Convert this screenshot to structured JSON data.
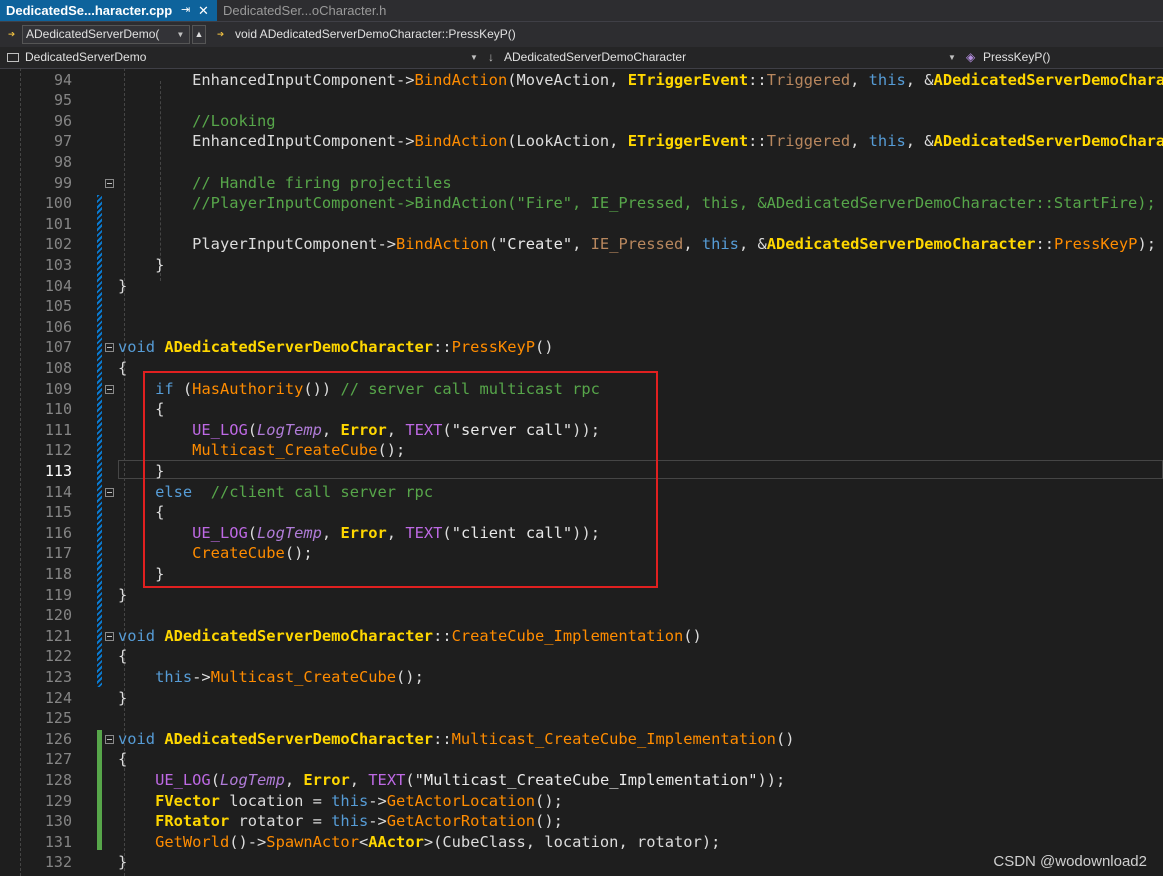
{
  "tabs": [
    {
      "label": "DedicatedSe...haracter.cpp",
      "active": true
    },
    {
      "label": "DedicatedSer...oCharacter.h",
      "active": false
    }
  ],
  "tab_icons": {
    "pin": "pin-icon",
    "close": "close-icon"
  },
  "toolbar": {
    "class_combo": "ADedicatedServerDemo(",
    "function_text": "void ADedicatedServerDemoCharacter::PressKeyP()"
  },
  "navbar": {
    "project": "DedicatedServerDemo",
    "scope": "ADedicatedServerDemoCharacter",
    "member": "PressKeyP()"
  },
  "editor": {
    "accent_colors": {
      "keyword": "#569cd6",
      "type": "#ffd700",
      "function": "#ff8c00",
      "macro": "#be69e4",
      "comment": "#57a64a"
    },
    "lines": [
      {
        "n": "94",
        "tokens": [
          [
            "        ",
            ""
          ],
          [
            "EnhancedInputComponent",
            "pl"
          ],
          [
            "->",
            ""
          ],
          [
            "BindAction",
            "fn"
          ],
          [
            "(MoveAction, ",
            ""
          ],
          [
            "ETriggerEvent",
            "ty"
          ],
          [
            "::",
            ""
          ],
          [
            "Triggered",
            "enm"
          ],
          [
            ", ",
            ""
          ],
          [
            "this",
            "kw"
          ],
          [
            ", &",
            ""
          ],
          [
            "ADedicatedServerDemoCharacter",
            "ty"
          ]
        ]
      },
      {
        "n": "95",
        "tokens": []
      },
      {
        "n": "96",
        "tokens": [
          [
            "        ",
            ""
          ],
          [
            "//Looking",
            "com"
          ]
        ]
      },
      {
        "n": "97",
        "tokens": [
          [
            "        ",
            ""
          ],
          [
            "EnhancedInputComponent",
            "pl"
          ],
          [
            "->",
            ""
          ],
          [
            "BindAction",
            "fn"
          ],
          [
            "(LookAction, ",
            ""
          ],
          [
            "ETriggerEvent",
            "ty"
          ],
          [
            "::",
            ""
          ],
          [
            "Triggered",
            "enm"
          ],
          [
            ", ",
            ""
          ],
          [
            "this",
            "kw"
          ],
          [
            ", &",
            ""
          ],
          [
            "ADedicatedServerDemoCharacter",
            "ty"
          ]
        ]
      },
      {
        "n": "98",
        "tokens": []
      },
      {
        "n": "99",
        "tokens": [
          [
            "        ",
            ""
          ],
          [
            "// Handle firing projectiles",
            "com"
          ]
        ]
      },
      {
        "n": "100",
        "tokens": [
          [
            "        ",
            ""
          ],
          [
            "//PlayerInputComponent->BindAction(\"Fire\", IE_Pressed, this, &ADedicatedServerDemoCharacter::StartFire);",
            "com"
          ]
        ]
      },
      {
        "n": "101",
        "tokens": []
      },
      {
        "n": "102",
        "tokens": [
          [
            "        ",
            ""
          ],
          [
            "PlayerInputComponent",
            ""
          ],
          [
            "->",
            ""
          ],
          [
            "BindAction",
            "fn"
          ],
          [
            "(",
            ""
          ],
          [
            "\"Create\"",
            "str"
          ],
          [
            ", ",
            ""
          ],
          [
            "IE_Pressed",
            "enm"
          ],
          [
            ", ",
            ""
          ],
          [
            "this",
            "kw"
          ],
          [
            ", &",
            ""
          ],
          [
            "ADedicatedServerDemoCharacter",
            "ty"
          ],
          [
            "::",
            ""
          ],
          [
            "PressKeyP",
            "fn"
          ],
          [
            ");",
            ""
          ]
        ]
      },
      {
        "n": "103",
        "tokens": [
          [
            "    }",
            ""
          ]
        ]
      },
      {
        "n": "104",
        "tokens": [
          [
            "}",
            ""
          ]
        ]
      },
      {
        "n": "105",
        "tokens": []
      },
      {
        "n": "106",
        "tokens": []
      },
      {
        "n": "107",
        "tokens": [
          [
            "void",
            "kw"
          ],
          [
            " ",
            ""
          ],
          [
            "ADedicatedServerDemoCharacter",
            "ty"
          ],
          [
            "::",
            ""
          ],
          [
            "PressKeyP",
            "fn"
          ],
          [
            "()",
            ""
          ]
        ]
      },
      {
        "n": "108",
        "tokens": [
          [
            "{",
            ""
          ]
        ]
      },
      {
        "n": "109",
        "tokens": [
          [
            "    ",
            ""
          ],
          [
            "if",
            "kw"
          ],
          [
            " (",
            ""
          ],
          [
            "HasAuthority",
            "fn"
          ],
          [
            "()) ",
            ""
          ],
          [
            "// server call multicast rpc",
            "com"
          ]
        ]
      },
      {
        "n": "110",
        "tokens": [
          [
            "    {",
            ""
          ]
        ]
      },
      {
        "n": "111",
        "tokens": [
          [
            "        ",
            ""
          ],
          [
            "UE_LOG",
            "mac"
          ],
          [
            "(",
            ""
          ],
          [
            "LogTemp",
            "ital"
          ],
          [
            ", ",
            ""
          ],
          [
            "Error",
            "ty"
          ],
          [
            ", ",
            ""
          ],
          [
            "TEXT",
            "mac"
          ],
          [
            "(",
            ""
          ],
          [
            "\"server call\"",
            "str"
          ],
          [
            "));",
            ""
          ]
        ]
      },
      {
        "n": "112",
        "tokens": [
          [
            "        ",
            ""
          ],
          [
            "Multicast_CreateCube",
            "fn"
          ],
          [
            "();",
            ""
          ]
        ]
      },
      {
        "n": "113",
        "tokens": [
          [
            "    }",
            ""
          ]
        ]
      },
      {
        "n": "114",
        "tokens": [
          [
            "    ",
            ""
          ],
          [
            "else",
            "kw"
          ],
          [
            "  ",
            ""
          ],
          [
            "//client call server rpc",
            "com"
          ]
        ]
      },
      {
        "n": "115",
        "tokens": [
          [
            "    {",
            ""
          ]
        ]
      },
      {
        "n": "116",
        "tokens": [
          [
            "        ",
            ""
          ],
          [
            "UE_LOG",
            "mac"
          ],
          [
            "(",
            ""
          ],
          [
            "LogTemp",
            "ital"
          ],
          [
            ", ",
            ""
          ],
          [
            "Error",
            "ty"
          ],
          [
            ", ",
            ""
          ],
          [
            "TEXT",
            "mac"
          ],
          [
            "(",
            ""
          ],
          [
            "\"client call\"",
            "str"
          ],
          [
            "));",
            ""
          ]
        ]
      },
      {
        "n": "117",
        "tokens": [
          [
            "        ",
            ""
          ],
          [
            "CreateCube",
            "fn"
          ],
          [
            "();",
            ""
          ]
        ]
      },
      {
        "n": "118",
        "tokens": [
          [
            "    }",
            ""
          ]
        ]
      },
      {
        "n": "119",
        "tokens": [
          [
            "}",
            ""
          ]
        ]
      },
      {
        "n": "120",
        "tokens": []
      },
      {
        "n": "121",
        "tokens": [
          [
            "void",
            "kw"
          ],
          [
            " ",
            ""
          ],
          [
            "ADedicatedServerDemoCharacter",
            "ty"
          ],
          [
            "::",
            ""
          ],
          [
            "CreateCube_Implementation",
            "fn"
          ],
          [
            "()",
            ""
          ]
        ]
      },
      {
        "n": "122",
        "tokens": [
          [
            "{",
            ""
          ]
        ]
      },
      {
        "n": "123",
        "tokens": [
          [
            "    ",
            ""
          ],
          [
            "this",
            "kw"
          ],
          [
            "->",
            ""
          ],
          [
            "Multicast_CreateCube",
            "fn"
          ],
          [
            "();",
            ""
          ]
        ]
      },
      {
        "n": "124",
        "tokens": [
          [
            "}",
            ""
          ]
        ]
      },
      {
        "n": "125",
        "tokens": []
      },
      {
        "n": "126",
        "tokens": [
          [
            "void",
            "kw"
          ],
          [
            " ",
            ""
          ],
          [
            "ADedicatedServerDemoCharacter",
            "ty"
          ],
          [
            "::",
            ""
          ],
          [
            "Multicast_CreateCube_Implementation",
            "fn"
          ],
          [
            "()",
            ""
          ]
        ]
      },
      {
        "n": "127",
        "tokens": [
          [
            "{",
            ""
          ]
        ]
      },
      {
        "n": "128",
        "tokens": [
          [
            "    ",
            ""
          ],
          [
            "UE_LOG",
            "mac"
          ],
          [
            "(",
            ""
          ],
          [
            "LogTemp",
            "ital"
          ],
          [
            ", ",
            ""
          ],
          [
            "Error",
            "ty"
          ],
          [
            ", ",
            ""
          ],
          [
            "TEXT",
            "mac"
          ],
          [
            "(",
            ""
          ],
          [
            "\"Multicast_CreateCube_Implementation\"",
            "str"
          ],
          [
            "));",
            ""
          ]
        ]
      },
      {
        "n": "129",
        "tokens": [
          [
            "    ",
            ""
          ],
          [
            "FVector",
            "ty"
          ],
          [
            " location = ",
            ""
          ],
          [
            "this",
            "kw"
          ],
          [
            "->",
            ""
          ],
          [
            "GetActorLocation",
            "fn"
          ],
          [
            "();",
            ""
          ]
        ]
      },
      {
        "n": "130",
        "tokens": [
          [
            "    ",
            ""
          ],
          [
            "FRotator",
            "ty"
          ],
          [
            " rotator = ",
            ""
          ],
          [
            "this",
            "kw"
          ],
          [
            "->",
            ""
          ],
          [
            "GetActorRotation",
            "fn"
          ],
          [
            "();",
            ""
          ]
        ]
      },
      {
        "n": "131",
        "tokens": [
          [
            "    ",
            ""
          ],
          [
            "GetWorld",
            "fn"
          ],
          [
            "()->",
            ""
          ],
          [
            "SpawnActor",
            "fn"
          ],
          [
            "<",
            ""
          ],
          [
            "AActor",
            "ty"
          ],
          [
            ">(CubeClass, location, rotator);",
            ""
          ]
        ]
      },
      {
        "n": "132",
        "tokens": [
          [
            "}",
            ""
          ]
        ]
      }
    ]
  },
  "watermark": "CSDN @wodownload2"
}
